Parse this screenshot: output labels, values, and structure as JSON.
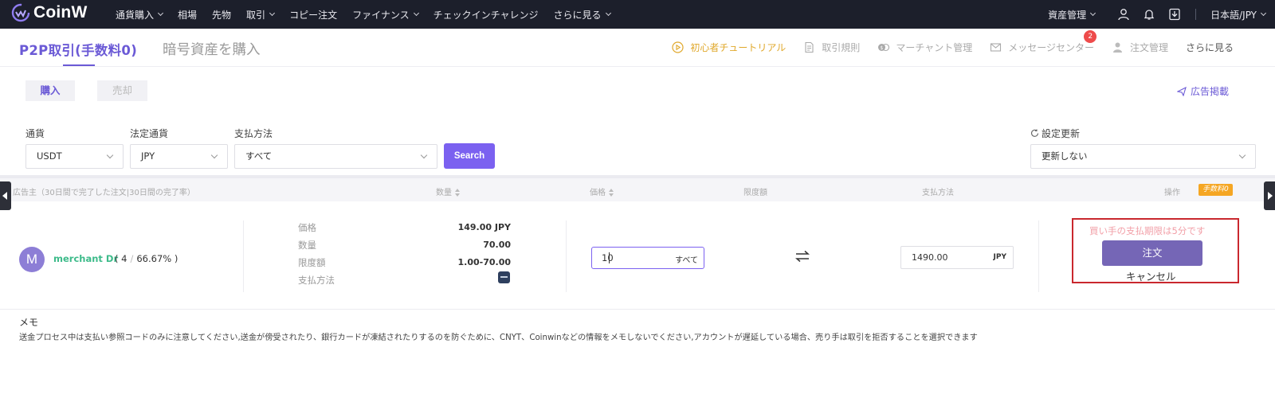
{
  "nav": {
    "logo": "CoinW",
    "items": [
      {
        "label": "通貨購入",
        "dropdown": true
      },
      {
        "label": "相場",
        "dropdown": false
      },
      {
        "label": "先物",
        "dropdown": false
      },
      {
        "label": "取引",
        "dropdown": true
      },
      {
        "label": "コピー注文",
        "dropdown": false
      },
      {
        "label": "ファイナンス",
        "dropdown": true
      },
      {
        "label": "チェックインチャレンジ",
        "dropdown": false
      },
      {
        "label": "さらに見る",
        "dropdown": true
      }
    ],
    "asset": "資産管理",
    "lang": "日本語/JPY",
    "icons": [
      "user-icon",
      "bell-icon",
      "download-icon"
    ]
  },
  "subhead": {
    "tab_active": "P2P取引(手数料0)",
    "tab_other": "暗号資産を購入",
    "links": {
      "tutorial": "初心者チュートリアル",
      "rules": "取引規則",
      "merchant": "マーチャント管理",
      "messages": "メッセージセンター",
      "messages_badge": "2",
      "orders": "注文管理",
      "more": "さらに見る"
    }
  },
  "actions": {
    "buy": "購入",
    "sell": "売却",
    "post_ad": "広告掲載"
  },
  "filters": {
    "currency_label": "通貨",
    "currency_value": "USDT",
    "fiat_label": "法定通貨",
    "fiat_value": "JPY",
    "payment_label": "支払方法",
    "payment_value": "すべて",
    "search": "Search",
    "refresh_label": "設定更新",
    "refresh_value": "更新しない"
  },
  "table": {
    "headers": {
      "advertiser": "広告主（30日間で完了した注文|30日間の完了率）",
      "quantity": "数量",
      "price": "価格",
      "limit": "限度額",
      "payment": "支払方法",
      "operation": "操作",
      "fee_tag": "手数料0"
    }
  },
  "row": {
    "avatar": "M",
    "merchant_name": "merchant Dr",
    "orders": "4",
    "rate": "66.67%",
    "price_label": "価格",
    "price_value": "149.00 JPY",
    "qty_label": "数量",
    "qty_value": "70.00",
    "limit_label": "限度額",
    "limit_value": "1.00-70.00",
    "payment_label": "支払方法",
    "input_qty": "10",
    "input_all": "すべて",
    "amount": "1490.00",
    "amount_unit": "JPY",
    "pay_limit": "買い手の支払期限は5分です",
    "order_btn": "注文",
    "cancel_btn": "キャンセル"
  },
  "memo": {
    "title": "メモ",
    "text": "送金プロセス中は支払い参照コードのみに注意してください,送金が傍受されたり、銀行カードが凍結されたりするのを防ぐために、CNYT、Coinwinなどの情報をメモしないでください,アカウントが遅延している場合、売り手は取引を拒否することを選択できます"
  },
  "colors": {
    "nav_bg": "#1c1f2b",
    "accent": "#6b5ad6",
    "search_btn": "#7b61f0",
    "order_btn": "#7566b6",
    "merchant_green": "#3dbb8a",
    "tutorial_gold": "#e0a82b",
    "highlight_red": "#c9282e"
  }
}
